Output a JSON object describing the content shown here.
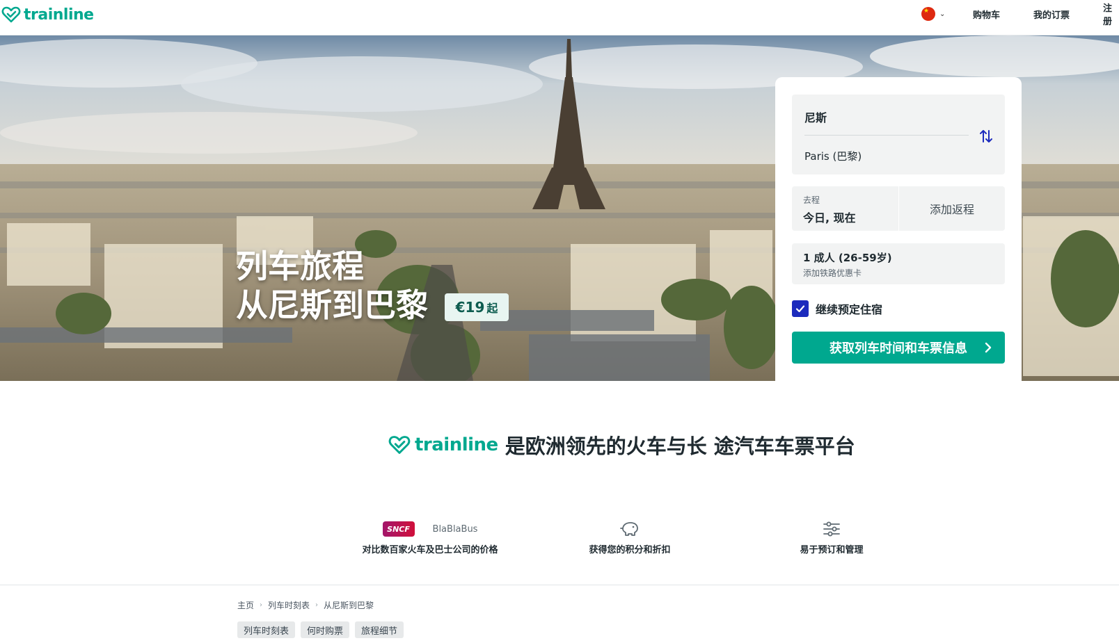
{
  "header": {
    "brand": "trainline",
    "nav": {
      "cart": "购物车",
      "orders": "我的订票",
      "register": "注册"
    }
  },
  "hero": {
    "title_line1": "列车旅程",
    "title_line2": "从尼斯到巴黎",
    "price": "€19",
    "price_suffix": "起"
  },
  "search": {
    "origin": "尼斯",
    "destination": "Paris (巴黎)",
    "outbound_label": "去程",
    "outbound_value": "今日, 现在",
    "return_label": "添加返程",
    "passengers": "1 成人 (26-59岁)",
    "railcard": "添加铁路优惠卡",
    "accommodation_label": "继续预定住宿",
    "accommodation_checked": true,
    "submit_label": "获取列车时间和车票信息"
  },
  "promo": {
    "brand": "trainline",
    "tagline": "是欧洲领先的火车与长 途汽车车票平台",
    "features": [
      {
        "label": "对比数百家火车及巴士公司的价格",
        "logos": [
          "SNCF",
          "BlaBlaBus"
        ]
      },
      {
        "label": "获得您的积分和折扣",
        "icon": "piggy-bank-icon"
      },
      {
        "label": "易于预订和管理",
        "icon": "sliders-icon"
      }
    ]
  },
  "breadcrumb": [
    "主页",
    "列车时刻表",
    "从尼斯到巴黎"
  ],
  "chips": [
    "列车时刻表",
    "何时购票",
    "旅程细节"
  ],
  "colors": {
    "brand": "#00a88f",
    "checkbox": "#1c2bbd"
  }
}
